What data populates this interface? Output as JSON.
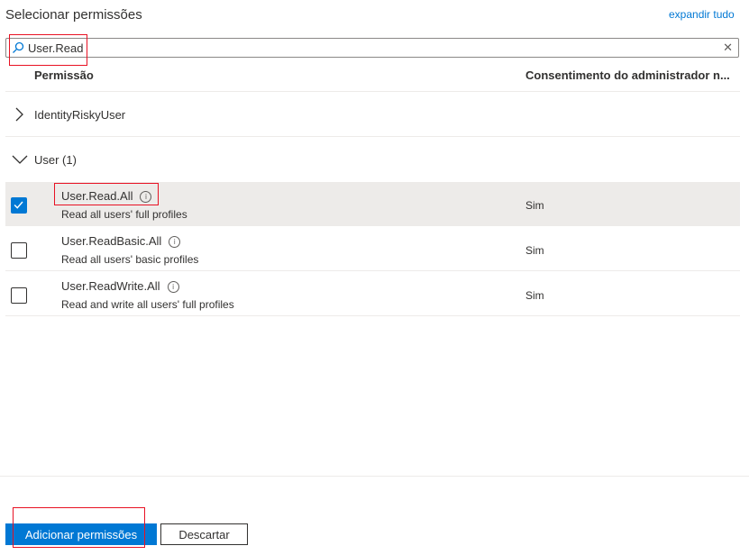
{
  "panel": {
    "title": "Selecionar permissões",
    "expand_all": "expandir tudo"
  },
  "search": {
    "value": "User.Read",
    "icon": "search-icon",
    "clear_icon": "close-icon"
  },
  "table": {
    "columns": [
      "Permissão",
      "Consentimento do administrador n..."
    ],
    "groups": [
      {
        "label": "IdentityRiskyUser",
        "expanded": false
      },
      {
        "label": "User (1)",
        "expanded": true
      }
    ],
    "permissions": [
      {
        "name": "User.Read.All",
        "description": "Read all users' full profiles",
        "admin_consent": "Sim",
        "checked": true
      },
      {
        "name": "User.ReadBasic.All",
        "description": "Read all users' basic profiles",
        "admin_consent": "Sim",
        "checked": false
      },
      {
        "name": "User.ReadWrite.All",
        "description": "Read and write all users' full profiles",
        "admin_consent": "Sim",
        "checked": false
      }
    ]
  },
  "footer": {
    "add_button": "Adicionar permissões",
    "discard_button": "Descartar"
  },
  "colors": {
    "accent": "#0078d4",
    "highlight_box": "#e81123",
    "selected_row": "#edebe9"
  }
}
